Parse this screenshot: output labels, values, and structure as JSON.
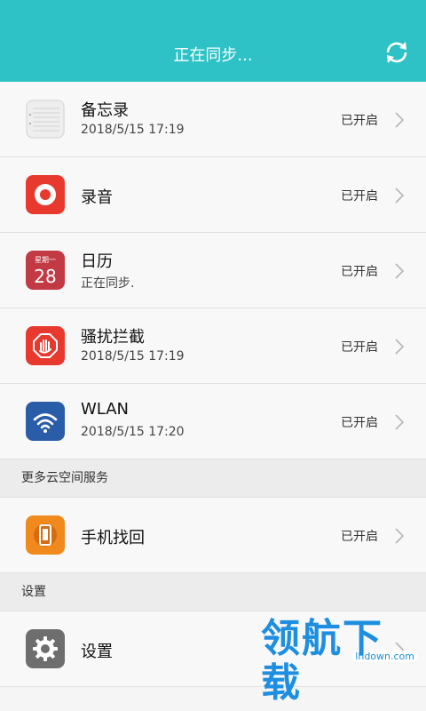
{
  "header": {
    "title": "正在同步..."
  },
  "items": [
    {
      "name": "备忘录",
      "sub": "2018/5/15 17:19",
      "status": "已开启"
    },
    {
      "name": "录音",
      "sub": "",
      "status": "已开启"
    },
    {
      "name": "日历",
      "sub": "正在同步.",
      "status": "已开启",
      "icon_text_top": "星期一",
      "icon_text_day": "28"
    },
    {
      "name": "骚扰拦截",
      "sub": "2018/5/15 17:19",
      "status": "已开启"
    },
    {
      "name": "WLAN",
      "sub": "2018/5/15 17:20",
      "status": "已开启"
    }
  ],
  "section_more": {
    "label": "更多云空间服务",
    "items": [
      {
        "name": "手机找回",
        "status": "已开启"
      }
    ]
  },
  "section_settings": {
    "label": "设置",
    "items": [
      {
        "name": "设置"
      }
    ]
  },
  "watermark": {
    "url": "lhdown.com",
    "brand": "领航下载"
  },
  "colors": {
    "header": "#2ec2c6",
    "recorder": "#e8392e",
    "calendar": "#c23a44",
    "block": "#e8392e",
    "wlan": "#2a5da8",
    "find_phone": "#f08a1d",
    "settings": "#6e6e6e"
  },
  "icons": {
    "sync": "sync-icon",
    "chevron": "chevron-right-icon"
  }
}
